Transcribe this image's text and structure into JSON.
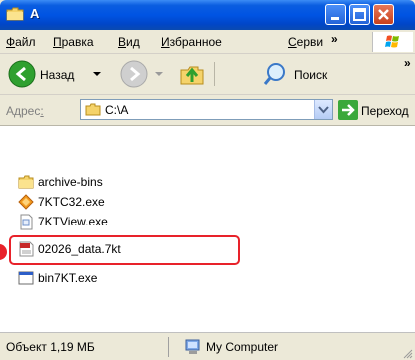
{
  "window": {
    "title": "A"
  },
  "menu": {
    "items": [
      {
        "pre": "",
        "u": "Ф",
        "post": "айл"
      },
      {
        "pre": "",
        "u": "П",
        "post": "равка"
      },
      {
        "pre": "",
        "u": "В",
        "post": "ид"
      },
      {
        "pre": "",
        "u": "И",
        "post": "збранное"
      },
      {
        "pre": "",
        "u": "С",
        "post": "ерви"
      }
    ],
    "more": "»"
  },
  "toolbar": {
    "back_label": "Назад",
    "search_label": "Поиск",
    "more": "»"
  },
  "address": {
    "label_pre": "Адрес",
    "label_u": ":",
    "value": "C:\\A",
    "go_label": "Переход"
  },
  "files": [
    {
      "name": "archive-bins",
      "icon": "folder-icon"
    },
    {
      "name": "7KTC32.exe",
      "icon": "diamond-app-icon"
    },
    {
      "name": "7KTView.exe",
      "icon": "app-file-icon"
    },
    {
      "name": "02026_data.7kt",
      "icon": "7kt-file-icon"
    },
    {
      "name": "bin7KT.exe",
      "icon": "exe-window-icon"
    }
  ],
  "status": {
    "left": "Объект 1,19 МБ",
    "right": "My Computer"
  },
  "colors": {
    "titlebar": "#0054e3",
    "highlight": "#e8222a"
  }
}
